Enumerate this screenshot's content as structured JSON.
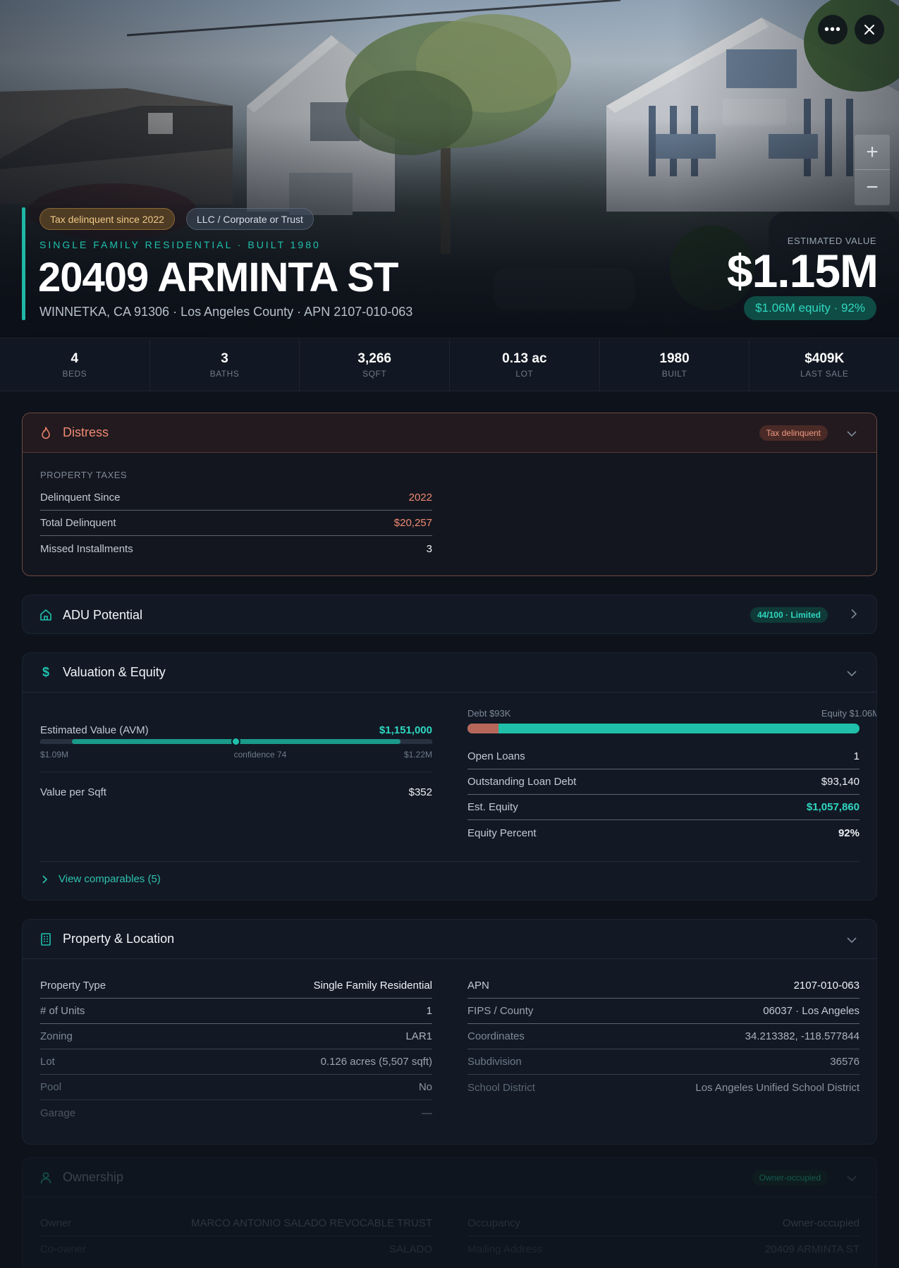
{
  "hero": {
    "chips": {
      "tax": "Tax delinquent since 2022",
      "llc": "LLC / Corporate or Trust"
    },
    "property_type_line": "SINGLE FAMILY RESIDENTIAL · BUILT 1980",
    "address": "20409 ARMINTA ST",
    "sub_address": "WINNETKA, CA 91306 · Los Angeles County · APN 2107-010-063",
    "estimated_label": "ESTIMATED VALUE",
    "estimated_value": "$1.15M",
    "equity_chip": "$1.06M equity · 92%",
    "more_icon": "more-horizontal-icon",
    "close_icon": "close-icon",
    "zoom_in": "+",
    "zoom_out": "−"
  },
  "stats": [
    {
      "value": "4",
      "label": "BEDS"
    },
    {
      "value": "3",
      "label": "BATHS"
    },
    {
      "value": "3,266",
      "label": "SQFT"
    },
    {
      "value": "0.13 ac",
      "label": "LOT"
    },
    {
      "value": "1980",
      "label": "BUILT"
    },
    {
      "value": "$409K",
      "label": "LAST SALE"
    }
  ],
  "distress": {
    "title": "Distress",
    "badge": "Tax delinquent",
    "section_label": "PROPERTY TAXES",
    "rows": [
      {
        "k": "Delinquent Since",
        "v": "2022"
      },
      {
        "k": "Total Delinquent",
        "v": "$20,257"
      },
      {
        "k": "Missed Installments",
        "v": "3"
      }
    ]
  },
  "adu": {
    "title": "ADU Potential",
    "badge": "44/100 · Limited"
  },
  "valuation": {
    "title": "Valuation & Equity",
    "avm_label": "Estimated Value (AVM)",
    "avm_value": "$1,151,000",
    "range_low": "$1.09M",
    "range_high": "$1.22M",
    "confidence": "confidence 74",
    "confidence_value": 74,
    "value_per_sqft_label": "Value per Sqft",
    "value_per_sqft": "$352",
    "debt_label": "Debt $93K",
    "equity_label": "Equity $1.06M",
    "debt_fraction": 0.08,
    "right_rows": [
      {
        "k": "Open Loans",
        "v": "1"
      },
      {
        "k": "Outstanding Loan Debt",
        "v": "$93,140"
      },
      {
        "k": "Est. Equity",
        "v": "$1,057,860"
      },
      {
        "k": "Equity Percent",
        "v": "92%"
      }
    ],
    "comparables": "View comparables (5)"
  },
  "property": {
    "title": "Property & Location",
    "left_rows": [
      {
        "k": "Property Type",
        "v": "Single Family Residential"
      },
      {
        "k": "# of Units",
        "v": "1"
      },
      {
        "k": "Zoning",
        "v": "LAR1"
      },
      {
        "k": "Lot",
        "v": "0.126 acres (5,507 sqft)"
      },
      {
        "k": "Pool",
        "v": "No"
      },
      {
        "k": "Garage",
        "v": "—"
      }
    ],
    "right_rows": [
      {
        "k": "APN",
        "v": "2107-010-063"
      },
      {
        "k": "FIPS / County",
        "v": "06037 · Los Angeles"
      },
      {
        "k": "Coordinates",
        "v": "34.213382, -118.577844"
      },
      {
        "k": "Subdivision",
        "v": "36576"
      },
      {
        "k": "School District",
        "v": "Los Angeles Unified School District"
      }
    ]
  },
  "ownership": {
    "title": "Ownership",
    "badge": "Owner-occupied",
    "left_rows": [
      {
        "k": "Owner",
        "v": "MARCO ANTONIO SALADO REVOCABLE TRUST"
      },
      {
        "k": "Co-owner",
        "v": "SALADO"
      }
    ],
    "right_rows": [
      {
        "k": "Occupancy",
        "v": "Owner-occupied"
      },
      {
        "k": "Mailing Address",
        "v": "20409 ARMINTA ST"
      }
    ]
  },
  "colors": {
    "accent": "#1fc1ad",
    "distress": "#e8806a",
    "tax_chip": "#f0c987"
  }
}
